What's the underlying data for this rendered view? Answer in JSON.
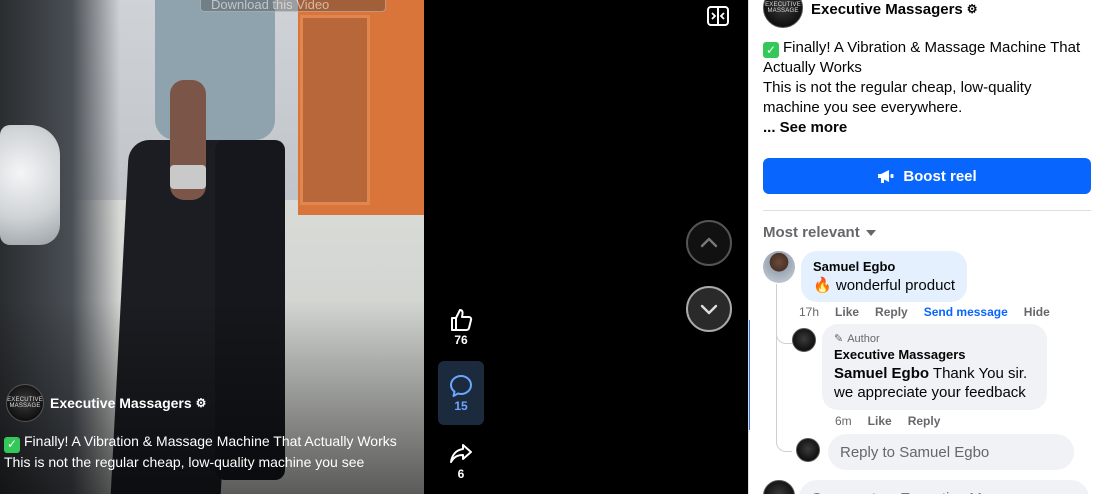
{
  "video": {
    "download_chip": "Download this Video",
    "author_name": "Executive Massagers",
    "avatar_text": "EXECUTIVE MASSAGE",
    "caption_line1": "Finally! A Vibration & Massage Machine That Actually Works",
    "caption_line2": "This is not the regular cheap, low-quality machine you see"
  },
  "reactions": {
    "likes": "76",
    "comments": "15",
    "shares": "6"
  },
  "post": {
    "author_name": "Executive Massagers",
    "caption_title": "Finally! A Vibration & Massage Machine That Actually Works",
    "caption_body": "This is not the regular cheap, low-quality machine you see everywhere.",
    "see_more": "... See more",
    "boost_label": "Boost reel"
  },
  "comments": {
    "sort_label": "Most relevant",
    "first": {
      "author": "Samuel Egbo",
      "emoji": "🔥",
      "text": "wonderful product",
      "time": "17h",
      "like": "Like",
      "reply": "Reply",
      "send_message": "Send message",
      "hide": "Hide"
    },
    "reply": {
      "author_tag": "Author",
      "author": "Executive Massagers",
      "mention": "Samuel Egbo",
      "text": " Thank You sir. we appreciate your feedback",
      "time": "6m",
      "like": "Like",
      "reply": "Reply"
    },
    "reply_placeholder": "Reply to Samuel Egbo",
    "comment_placeholder": "Comment as Executive Massagers"
  },
  "colors": {
    "accent": "#0866ff",
    "comment_bubble": "#e4f0fd",
    "check_green": "#34c759"
  }
}
